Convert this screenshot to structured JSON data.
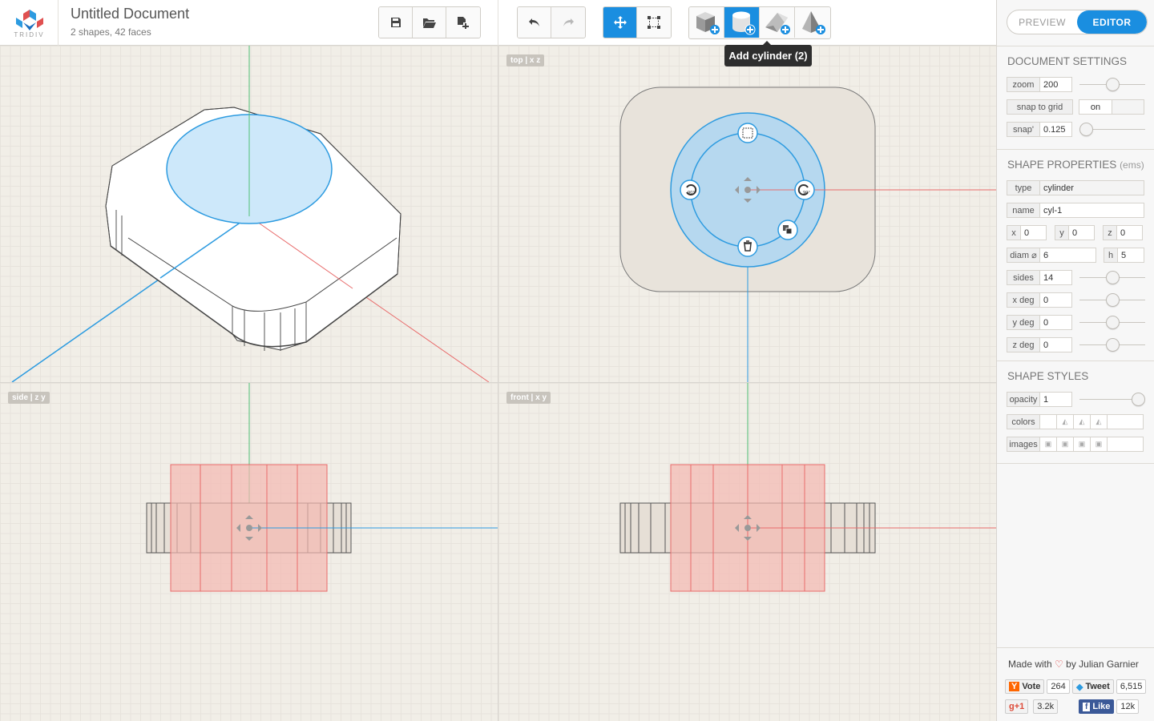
{
  "app": {
    "logo_text": "TRIDIV",
    "title": "Untitled Document",
    "subtitle": "2 shapes, 42 faces"
  },
  "toolbar": {
    "tooltip": "Add cylinder (2)"
  },
  "viewports": {
    "top_label": "top | x z",
    "side_label": "side | z y",
    "front_label": "front | x y"
  },
  "mode": {
    "preview": "PREVIEW",
    "editor": "EDITOR",
    "active": "editor"
  },
  "document_settings": {
    "title": "DOCUMENT SETTINGS",
    "zoom_label": "zoom",
    "zoom_value": "200",
    "zoom_level": 0.5,
    "snap_label": "snap to grid",
    "snap_value": "on",
    "snap2_label": "snap'",
    "snap2_value": "0.125",
    "snap2_level": 0.0
  },
  "shape_properties": {
    "title": "SHAPE PROPERTIES",
    "unit": "(ems)",
    "type_label": "type",
    "type_value": "cylinder",
    "name_label": "name",
    "name_value": "cyl-1",
    "x_label": "x",
    "x_value": "0",
    "y_label": "y",
    "y_value": "0",
    "z_label": "z",
    "z_value": "0",
    "diam_label": "diam ⌀",
    "diam_value": "6",
    "h_label": "h",
    "h_value": "5",
    "sides_label": "sides",
    "sides_value": "14",
    "sides_level": 0.5,
    "xdeg_label": "x deg",
    "xdeg_value": "0",
    "xdeg_level": 0.5,
    "ydeg_label": "y deg",
    "ydeg_value": "0",
    "ydeg_level": 0.5,
    "zdeg_label": "z deg",
    "zdeg_value": "0",
    "zdeg_level": 0.5
  },
  "shape_styles": {
    "title": "SHAPE STYLES",
    "opacity_label": "opacity",
    "opacity_value": "1",
    "opacity_level": 1.0,
    "colors_label": "colors",
    "images_label": "images"
  },
  "footer": {
    "made_with": "Made with",
    "heart": "♡",
    "by": "by Julian Garnier",
    "vote_label": "Vote",
    "vote_count": "264",
    "tweet_label": "Tweet",
    "tweet_count": "6,515",
    "gplus_label": "+1",
    "gplus_count": "3.2k",
    "like_label": "Like",
    "like_count": "12k"
  },
  "colors": {
    "accent": "#1a8ee0",
    "axis_x": "#e86b6b",
    "axis_z": "#2d9be0",
    "axis_y": "#4fbf75",
    "shape_red": "#f3b8b0"
  }
}
